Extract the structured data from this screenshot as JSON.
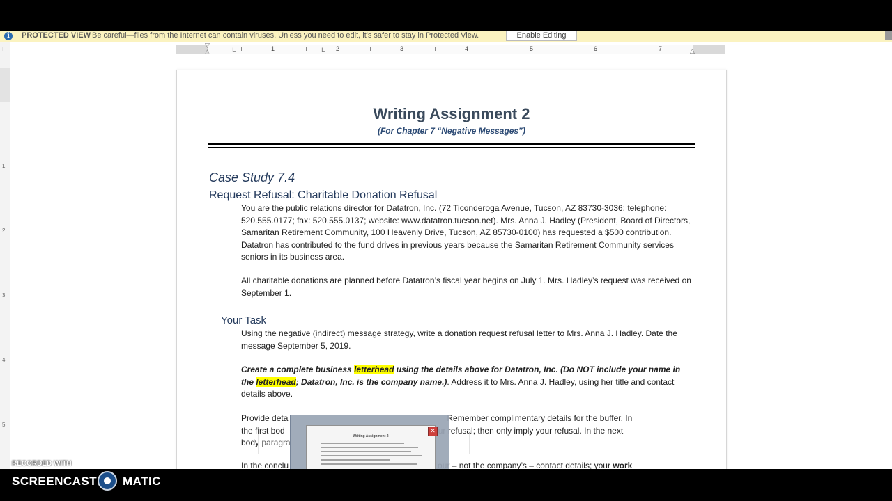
{
  "protected_view": {
    "label": "PROTECTED VIEW",
    "message": "Be careful—files from the Internet can contain viruses. Unless you need to edit, it's safer to stay in Protected View.",
    "enable_button": "Enable Editing"
  },
  "ruler": {
    "numbers": [
      "1",
      "2",
      "3",
      "4",
      "5",
      "6",
      "7"
    ],
    "vertical_numbers": [
      "1",
      "2",
      "3",
      "4",
      "5"
    ],
    "tab_selector": "L"
  },
  "document": {
    "title": "Writing Assignment 2",
    "subtitle": "(For Chapter 7 “Negative Messages”)",
    "case_heading": "Case Study 7.4",
    "request_heading": "Request Refusal: Charitable Donation Refusal",
    "paragraph1": "You are the public relations director for Datatron, Inc. (72 Ticonderoga Avenue, Tucson, AZ 83730-3036; telephone: 520.555.0177; fax: 520.555.0137; website: www.datatron.tucson.net). Mrs. Anna J. Hadley (President, Board of Directors, Samaritan Retirement Community, 100 Heavenly Drive, Tucson, AZ 85730-0100) has requested a $500 contribution. Datatron has contributed to the fund drives in previous years because the Samaritan Retirement Community services seniors in its business area.",
    "paragraph2": "All charitable donations are planned before Datatron’s fiscal year begins on July 1. Mrs. Hadley’s request was received on September 1.",
    "task_heading": "Your Task",
    "paragraph3": "Using the negative (indirect) message strategy, write a donation request refusal letter to Mrs. Anna J. Hadley. Date the message September 5, 2019.",
    "p4_part1": "Create a complete business ",
    "p4_hl1": "letterhead",
    "p4_part2": " using the details above for Datatron, Inc. (Do NOT include your name in the ",
    "p4_hl2": "letterhead",
    "p4_part3": "; Datatron, Inc. is the company name.)",
    "p4_part4": ". Address it to Mrs. Anna J. Hadley, using her title and contact details above.",
    "p5_line1_a": "Provide deta",
    "p5_line1_b": "Remember complimentary details for the buffer. In",
    "p5_line2_a": "the first bod",
    "p5_line2_b": "ur refusal; then only imply your refusal. In the next",
    "p5_line3_a": "body paragra",
    "p6_a": "In the conclu",
    "p6_b": "our – not the company’s –  contact details; your ",
    "p6_bold": "work"
  },
  "overlay": {
    "thumb_title": "Writing Assignment 2"
  },
  "watermark": {
    "recorded_with": "RECORDED WITH",
    "brand_left": "SCREENCAST",
    "brand_right": "MATIC"
  }
}
